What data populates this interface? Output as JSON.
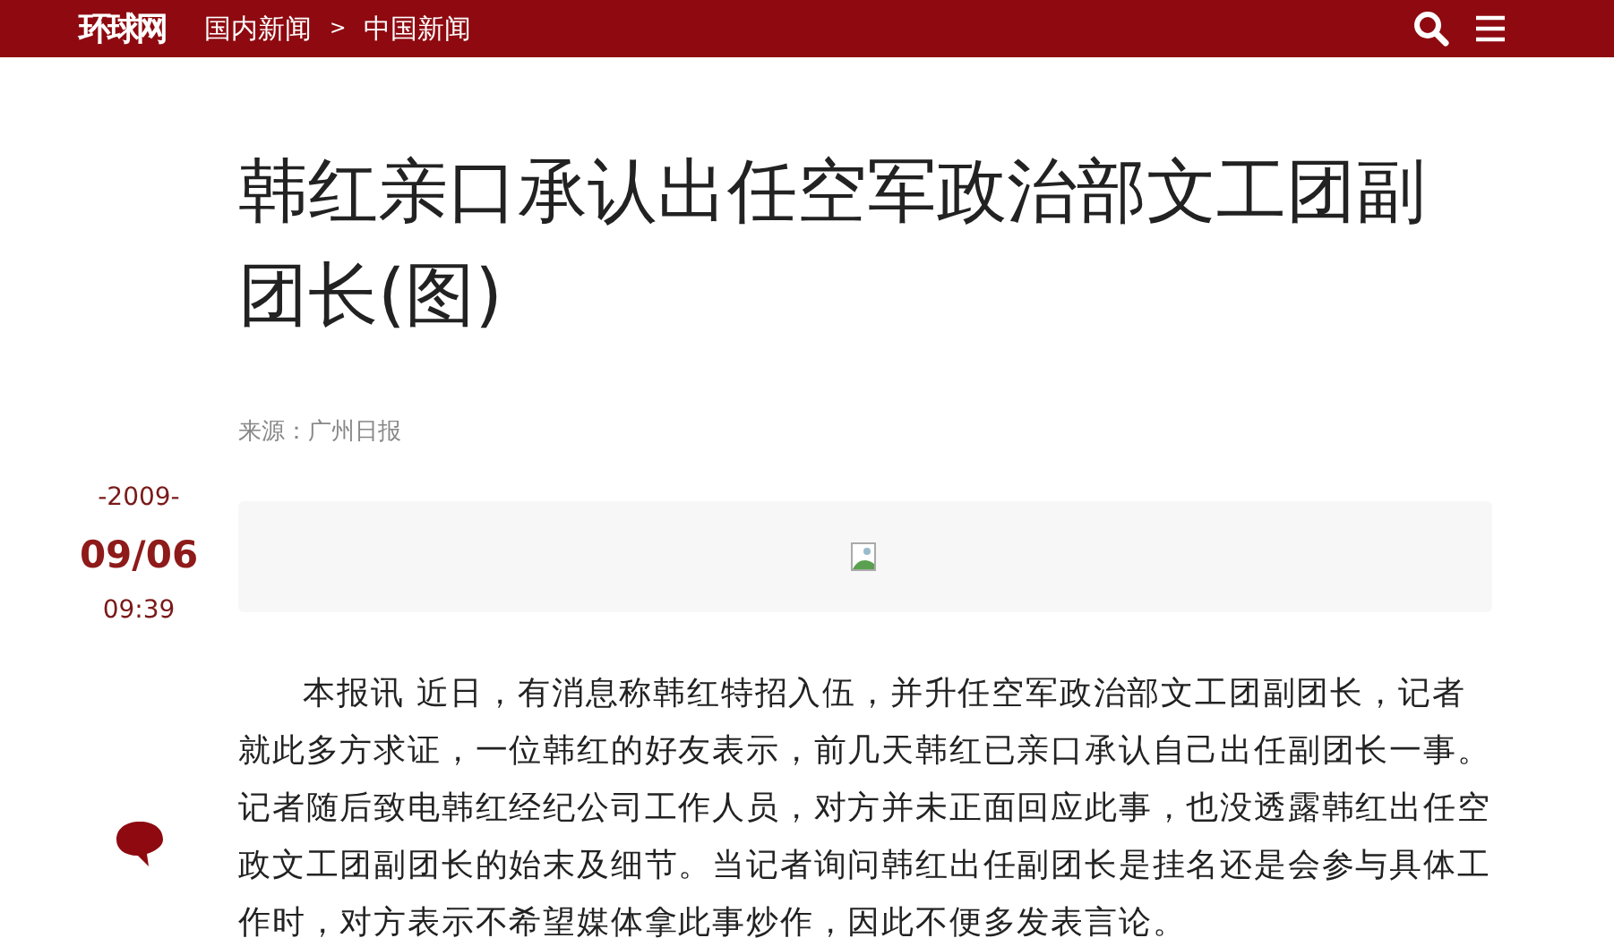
{
  "header": {
    "logo": "环球网",
    "breadcrumb": [
      "国内新闻",
      "中国新闻"
    ],
    "separator": ">"
  },
  "article": {
    "title": "韩红亲口承认出任空军政治部文工团副团长(图)",
    "source": "来源：广州日报",
    "date": {
      "year": "-2009-",
      "day": "09/06",
      "time": "09:39"
    },
    "body": "本报讯 近日，有消息称韩红特招入伍，并升任空军政治部文工团副团长，记者就此多方求证，一位韩红的好友表示，前几天韩红已亲口承认自己出任副团长一事。记者随后致电韩红经纪公司工作人员，对方并未正面回应此事，也没透露韩红出任空政文工团副团长的始末及细节。当记者询问韩红出任副团长是挂名还是会参与具体工作时，对方表示不希望媒体拿此事炒作，因此不便多发表言论。"
  }
}
